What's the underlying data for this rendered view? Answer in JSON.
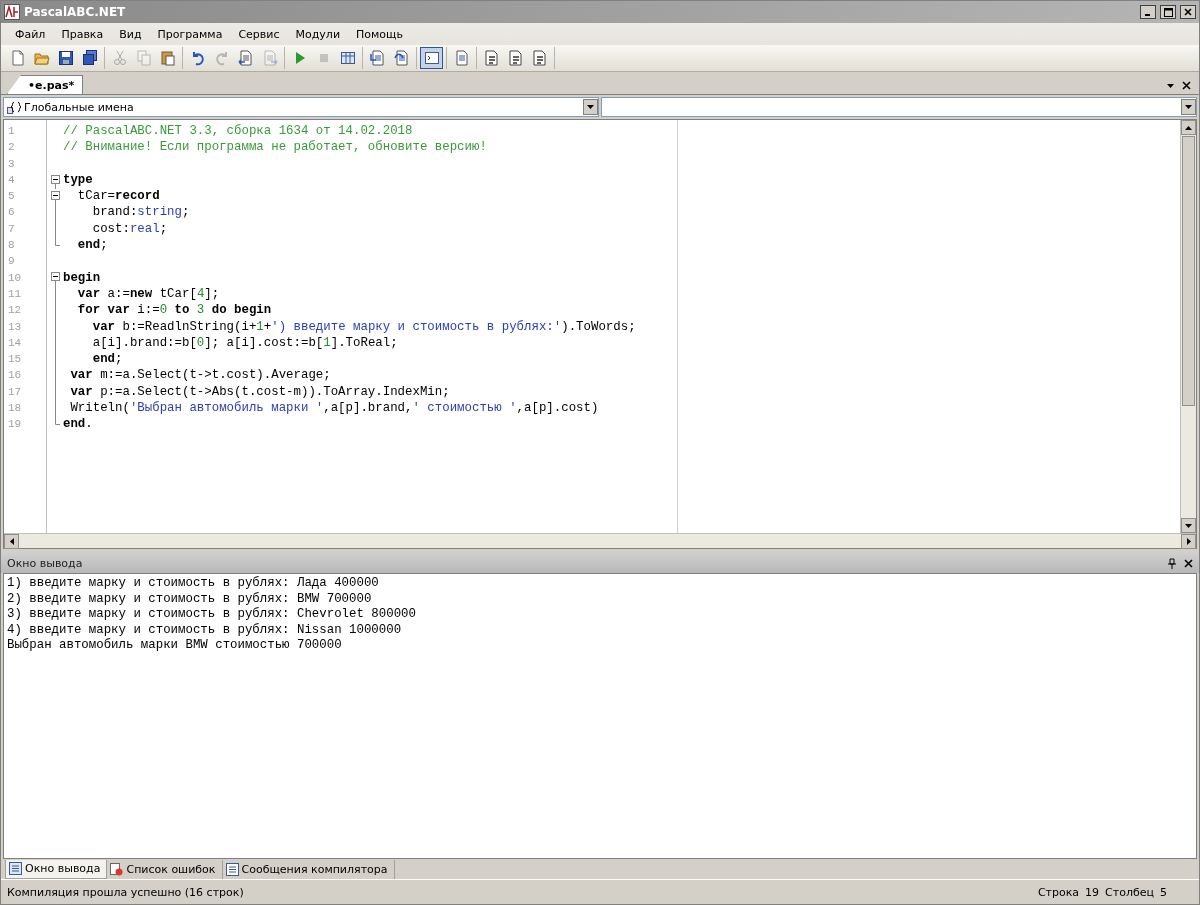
{
  "window": {
    "title": "PascalABC.NET"
  },
  "menu": [
    "Файл",
    "Правка",
    "Вид",
    "Программа",
    "Сервис",
    "Модули",
    "Помощь"
  ],
  "toolbar": [
    [
      {
        "kind": "new",
        "disabled": false,
        "pressed": false
      },
      {
        "kind": "open",
        "disabled": false,
        "pressed": false
      },
      {
        "kind": "save",
        "disabled": false,
        "pressed": false
      },
      {
        "kind": "save-all",
        "disabled": false,
        "pressed": false
      }
    ],
    [
      {
        "kind": "cut",
        "disabled": true,
        "pressed": false
      },
      {
        "kind": "copy",
        "disabled": true,
        "pressed": false
      },
      {
        "kind": "paste",
        "disabled": false,
        "pressed": false
      }
    ],
    [
      {
        "kind": "undo",
        "disabled": false,
        "pressed": false
      },
      {
        "kind": "redo",
        "disabled": true,
        "pressed": false
      },
      {
        "kind": "back",
        "disabled": false,
        "pressed": false
      },
      {
        "kind": "forward",
        "disabled": true,
        "pressed": false
      }
    ],
    [
      {
        "kind": "run",
        "disabled": false,
        "pressed": false
      },
      {
        "kind": "stop",
        "disabled": true,
        "pressed": false
      },
      {
        "kind": "grid",
        "disabled": false,
        "pressed": false
      }
    ],
    [
      {
        "kind": "step-into",
        "disabled": false,
        "pressed": false
      },
      {
        "kind": "step-over",
        "disabled": false,
        "pressed": false
      }
    ],
    [
      {
        "kind": "console",
        "disabled": false,
        "pressed": true
      }
    ],
    [
      {
        "kind": "compile",
        "disabled": false,
        "pressed": false
      }
    ],
    [
      {
        "kind": "module",
        "disabled": false,
        "pressed": false
      },
      {
        "kind": "module",
        "disabled": false,
        "pressed": false
      },
      {
        "kind": "module",
        "disabled": false,
        "pressed": false
      }
    ]
  ],
  "document_tabs": [
    {
      "label": "•e.pas*",
      "selected": true
    }
  ],
  "scope_combo": {
    "value": "Глобальные имена"
  },
  "editor": {
    "lines": [
      {
        "number": "1",
        "kind": "plain",
        "tokens": [
          {
            "kind": "comment",
            "text": "// PascalABC.NET 3.3, сборка 1634 от 14.02.2018"
          }
        ]
      },
      {
        "number": "2",
        "kind": "plain",
        "tokens": [
          {
            "kind": "comment",
            "text": "// Внимание! Если программа не работает, обновите версию!"
          }
        ]
      },
      {
        "number": "3",
        "kind": "plain"
      },
      {
        "number": "4",
        "kind": "fold-start",
        "tokens": [
          {
            "kind": "keyword",
            "text": "type"
          }
        ]
      },
      {
        "number": "5",
        "kind": "fold-start",
        "tokens": [
          {
            "kind": "plain",
            "text": "  tCar="
          },
          {
            "kind": "keyword",
            "text": "record"
          }
        ]
      },
      {
        "number": "6",
        "kind": "fold-inside",
        "tokens": [
          {
            "kind": "plain",
            "text": "    brand:"
          },
          {
            "kind": "type",
            "text": "string"
          },
          {
            "kind": "plain",
            "text": ";"
          }
        ]
      },
      {
        "number": "7",
        "kind": "fold-inside",
        "tokens": [
          {
            "kind": "plain",
            "text": "    cost:"
          },
          {
            "kind": "type",
            "text": "real"
          },
          {
            "kind": "plain",
            "text": ";"
          }
        ]
      },
      {
        "number": "8",
        "kind": "fold-end",
        "tokens": [
          {
            "kind": "keyword",
            "text": "  end"
          },
          {
            "kind": "plain",
            "text": ";"
          }
        ]
      },
      {
        "number": "9",
        "kind": "plain"
      },
      {
        "number": "10",
        "kind": "fold-start",
        "tokens": [
          {
            "kind": "keyword",
            "text": "begin"
          }
        ]
      },
      {
        "number": "11",
        "kind": "fold-inside",
        "tokens": [
          {
            "kind": "keyword",
            "text": "  var"
          },
          {
            "kind": "plain",
            "text": " a:="
          },
          {
            "kind": "keyword",
            "text": "new"
          },
          {
            "kind": "plain",
            "text": " tCar["
          },
          {
            "kind": "number",
            "text": "4"
          },
          {
            "kind": "plain",
            "text": "];"
          }
        ]
      },
      {
        "number": "12",
        "kind": "fold-inside",
        "tokens": [
          {
            "kind": "keyword",
            "text": "  for var"
          },
          {
            "kind": "plain",
            "text": " i:="
          },
          {
            "kind": "number",
            "text": "0"
          },
          {
            "kind": "keyword",
            "text": " to "
          },
          {
            "kind": "number",
            "text": "3"
          },
          {
            "kind": "keyword",
            "text": " do begin"
          }
        ]
      },
      {
        "number": "13",
        "kind": "fold-inside",
        "tokens": [
          {
            "kind": "keyword",
            "text": "    var"
          },
          {
            "kind": "plain",
            "text": " b:=ReadlnString(i+"
          },
          {
            "kind": "number",
            "text": "1"
          },
          {
            "kind": "plain",
            "text": "+"
          },
          {
            "kind": "string",
            "text": "') введите марку и стоимость в рублях:'"
          },
          {
            "kind": "plain",
            "text": ").ToWords;"
          }
        ]
      },
      {
        "number": "14",
        "kind": "fold-inside",
        "tokens": [
          {
            "kind": "plain",
            "text": "    a[i].brand:=b["
          },
          {
            "kind": "number",
            "text": "0"
          },
          {
            "kind": "plain",
            "text": "]; a[i].cost:=b["
          },
          {
            "kind": "number",
            "text": "1"
          },
          {
            "kind": "plain",
            "text": "].ToReal;"
          }
        ]
      },
      {
        "number": "15",
        "kind": "fold-inside",
        "tokens": [
          {
            "kind": "keyword",
            "text": "    end"
          },
          {
            "kind": "plain",
            "text": ";"
          }
        ]
      },
      {
        "number": "16",
        "kind": "fold-inside",
        "tokens": [
          {
            "kind": "keyword",
            "text": " var"
          },
          {
            "kind": "plain",
            "text": " m:=a.Select(t->t.cost).Average;"
          }
        ]
      },
      {
        "number": "17",
        "kind": "fold-inside",
        "tokens": [
          {
            "kind": "keyword",
            "text": " var"
          },
          {
            "kind": "plain",
            "text": " p:=a.Select(t->Abs(t.cost-m)).ToArray.IndexMin;"
          }
        ]
      },
      {
        "number": "18",
        "kind": "fold-inside",
        "tokens": [
          {
            "kind": "plain",
            "text": " Writeln("
          },
          {
            "kind": "string",
            "text": "'Выбран автомобиль марки '"
          },
          {
            "kind": "plain",
            "text": ",a[p].brand,"
          },
          {
            "kind": "string",
            "text": "' стоимостью '"
          },
          {
            "kind": "plain",
            "text": ",a[p].cost)"
          }
        ]
      },
      {
        "number": "19",
        "kind": "fold-end",
        "tokens": [
          {
            "kind": "keyword",
            "text": "end"
          },
          {
            "kind": "plain",
            "text": "."
          }
        ]
      }
    ]
  },
  "output_panel": {
    "title": "Окно вывода",
    "lines": [
      "1) введите марку и стоимость в рублях: Лада 400000",
      "2) введите марку и стоимость в рублях: BMW 700000",
      "3) введите марку и стоимость в рублях: Chevrolet 800000",
      "4) введите марку и стоимость в рублях: Nissan 1000000",
      "Выбран автомобиль марки BMW стоимостью 700000"
    ]
  },
  "bottom_tabs": [
    {
      "label": "Окно вывода",
      "kind": "output",
      "selected": true
    },
    {
      "label": "Список ошибок",
      "kind": "errors",
      "selected": false
    },
    {
      "label": "Сообщения компилятора",
      "kind": "messages",
      "selected": false
    }
  ],
  "status_bar": {
    "message": "Компиляция прошла успешно (16 строк)",
    "line_label": "Строка",
    "line": "19",
    "column_label": "Столбец",
    "column": "5"
  }
}
